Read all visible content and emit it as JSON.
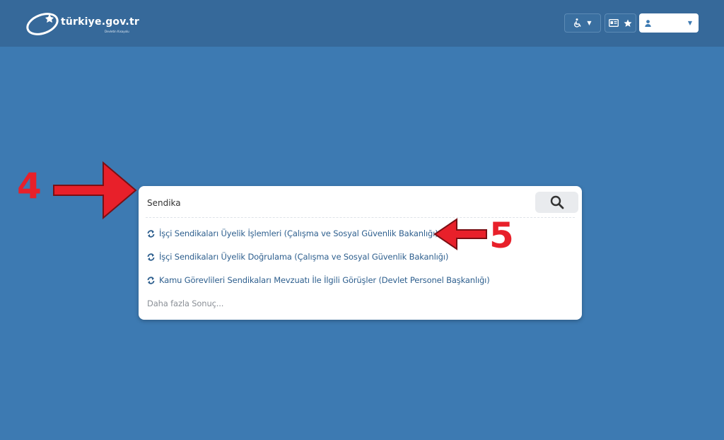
{
  "header": {
    "logo_text": "türkiye.gov.tr",
    "logo_tagline": "Devletin Kısayolu",
    "accessibility_icon": "wheelchair-icon",
    "favorites_icons": [
      "id-card-icon",
      "star-icon"
    ],
    "user_icon": "user-icon"
  },
  "search": {
    "query": "Sendika",
    "button_icon": "search-icon",
    "results": [
      {
        "label": "İşçi Sendikaları Üyelik İşlemleri (Çalışma ve Sosyal Güvenlik Bakanlığı)",
        "icon": "refresh-icon"
      },
      {
        "label": "İşçi Sendikaları Üyelik Doğrulama (Çalışma ve Sosyal Güvenlik Bakanlığı)",
        "icon": "refresh-icon"
      },
      {
        "label": "Kamu Görevlileri Sendikaları Mevzuatı İle İlgili Görüşler (Devlet Personel Başkanlığı)",
        "icon": "refresh-icon"
      }
    ],
    "more_label": "Daha fazla Sonuç..."
  },
  "annotations": {
    "step_4": "4",
    "step_5": "5"
  },
  "colors": {
    "background": "#3d7ab2",
    "header": "#36699a",
    "link": "#2e5f8e",
    "annotation": "#e8202a"
  }
}
